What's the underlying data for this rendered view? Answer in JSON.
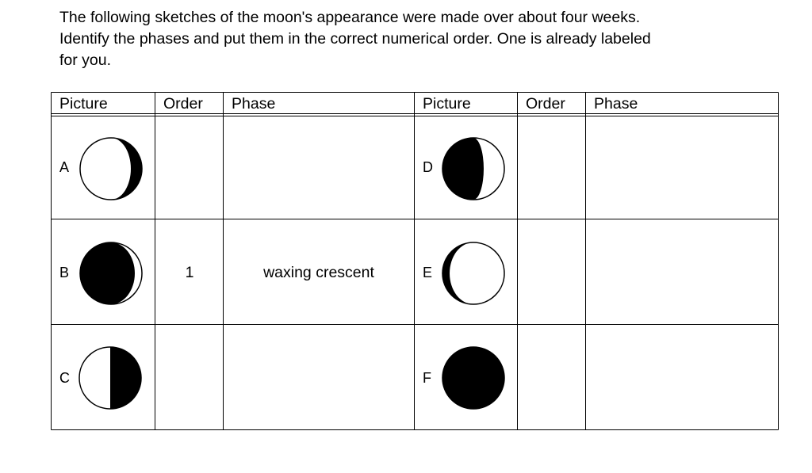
{
  "instructions": [
    "The following sketches of the moon's appearance were made over about four weeks.",
    "Identify the phases and put them in the correct numerical order. One is already labeled",
    "for you."
  ],
  "table": {
    "headers": [
      "Picture",
      "Order",
      "Phase",
      "Picture",
      "Order",
      "Phase"
    ],
    "rows": [
      {
        "left": {
          "letter": "A",
          "moon": "waxing-crescent-like-moon-icon",
          "order": "",
          "phase": ""
        },
        "right": {
          "letter": "D",
          "moon": "waning-gibbous-like-moon-icon",
          "order": "",
          "phase": ""
        }
      },
      {
        "left": {
          "letter": "B",
          "moon": "thin-crescent-moon-icon",
          "order": "1",
          "phase": "waxing crescent"
        },
        "right": {
          "letter": "E",
          "moon": "full-moon-icon",
          "order": "",
          "phase": ""
        }
      },
      {
        "left": {
          "letter": "C",
          "moon": "half-moon-icon",
          "order": "",
          "phase": ""
        },
        "right": {
          "letter": "F",
          "moon": "new-moon-icon",
          "order": "",
          "phase": ""
        }
      }
    ]
  }
}
